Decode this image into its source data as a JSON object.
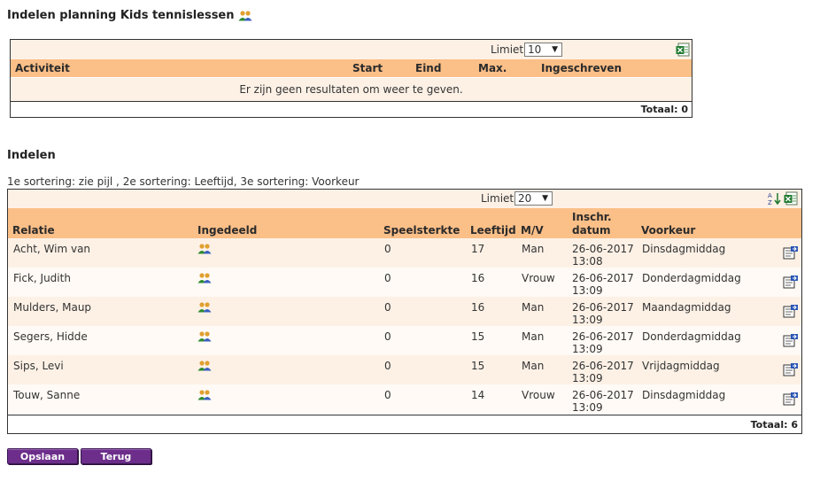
{
  "page": {
    "title": "Indelen planning Kids tennislessen"
  },
  "activities": {
    "limiet_label": "Limiet",
    "limiet_value": "10",
    "columns": {
      "activiteit": "Activiteit",
      "start": "Start",
      "eind": "Eind",
      "max": "Max.",
      "ingeschreven": "Ingeschreven"
    },
    "empty_message": "Er zijn geen resultaten om weer te geven.",
    "totaal": "Totaal: 0"
  },
  "indelen": {
    "title": "Indelen",
    "sort_note": "1e sortering: zie pijl , 2e sortering: Leeftijd, 3e sortering: Voorkeur",
    "limiet_label": "Limiet",
    "limiet_value": "20",
    "columns": {
      "relatie": "Relatie",
      "ingedeeld": "Ingedeeld",
      "speelsterkte": "Speelsterkte",
      "leeftijd": "Leeftijd",
      "mv": "M/V",
      "inschr_line1": "Inschr.",
      "inschr_line2": "datum",
      "voorkeur": "Voorkeur"
    },
    "rows": [
      {
        "relatie": "Acht, Wim van",
        "speelsterkte": "0",
        "leeftijd": "17",
        "mv": "Man",
        "datum": "26-06-2017",
        "tijd": "13:08",
        "voorkeur": "Dinsdagmiddag"
      },
      {
        "relatie": "Fick, Judith",
        "speelsterkte": "0",
        "leeftijd": "16",
        "mv": "Vrouw",
        "datum": "26-06-2017",
        "tijd": "13:09",
        "voorkeur": "Donderdagmiddag"
      },
      {
        "relatie": "Mulders, Maup",
        "speelsterkte": "0",
        "leeftijd": "16",
        "mv": "Man",
        "datum": "26-06-2017",
        "tijd": "13:09",
        "voorkeur": "Maandagmiddag"
      },
      {
        "relatie": "Segers, Hidde",
        "speelsterkte": "0",
        "leeftijd": "15",
        "mv": "Man",
        "datum": "26-06-2017",
        "tijd": "13:09",
        "voorkeur": "Donderdagmiddag"
      },
      {
        "relatie": "Sips, Levi",
        "speelsterkte": "0",
        "leeftijd": "15",
        "mv": "Man",
        "datum": "26-06-2017",
        "tijd": "13:09",
        "voorkeur": "Vrijdagmiddag"
      },
      {
        "relatie": "Touw, Sanne",
        "speelsterkte": "0",
        "leeftijd": "14",
        "mv": "Vrouw",
        "datum": "26-06-2017",
        "tijd": "13:09",
        "voorkeur": "Dinsdagmiddag"
      }
    ],
    "totaal": "Totaal: 6"
  },
  "buttons": {
    "opslaan": "Opslaan",
    "terug": "Terug"
  },
  "colors": {
    "header_bg": "#fbbf88",
    "row_odd_bg": "#fdf1e6",
    "button_bg": "#6c2e8a"
  },
  "icons": {
    "title_icon": "users-icon",
    "export": "excel-export-icon",
    "sort": "sort-az-icon",
    "ingedeeld": "users-icon",
    "row_action": "edit-assign-icon"
  }
}
